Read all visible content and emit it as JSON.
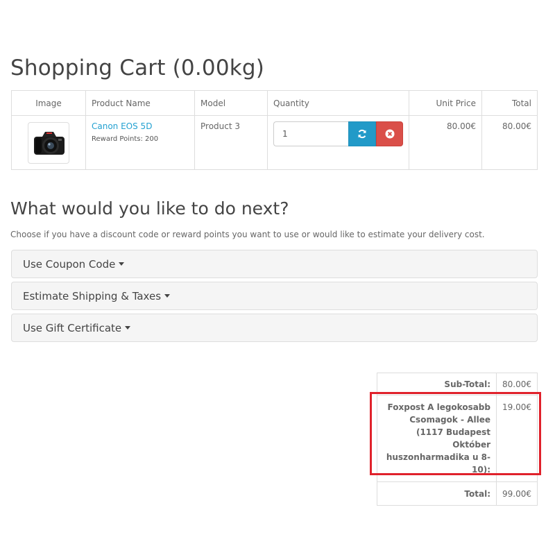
{
  "cart": {
    "title": "Shopping Cart  (0.00kg)",
    "columns": {
      "image": "Image",
      "name": "Product Name",
      "model": "Model",
      "quantity": "Quantity",
      "unit_price": "Unit Price",
      "total": "Total"
    },
    "items": [
      {
        "name": "Canon EOS 5D",
        "reward": "Reward Points: 200",
        "model": "Product 3",
        "quantity": "1",
        "unit_price": "80.00€",
        "total": "80.00€",
        "image_icon": "camera-icon"
      }
    ],
    "update_icon": "refresh-icon",
    "remove_icon": "remove-circle-icon"
  },
  "next": {
    "title": "What would you like to do next?",
    "description": "Choose if you have a discount code or reward points you want to use or would like to estimate your delivery cost.",
    "panels": [
      {
        "label": "Use Coupon Code"
      },
      {
        "label": "Estimate Shipping & Taxes"
      },
      {
        "label": "Use Gift Certificate"
      }
    ]
  },
  "totals": {
    "subtotal_label": "Sub-Total:",
    "subtotal_value": "80.00€",
    "shipping_label": "Foxpost A legokosabb Csomagok - Allee (1117 Budapest Október huszonharmadika u 8-10):",
    "shipping_value": "19.00€",
    "total_label": "Total:",
    "total_value": "99.00€"
  },
  "colors": {
    "link": "#23a1d1",
    "update_button": "#229ac8",
    "remove_button": "#da4f49",
    "highlight": "#e0212b"
  }
}
